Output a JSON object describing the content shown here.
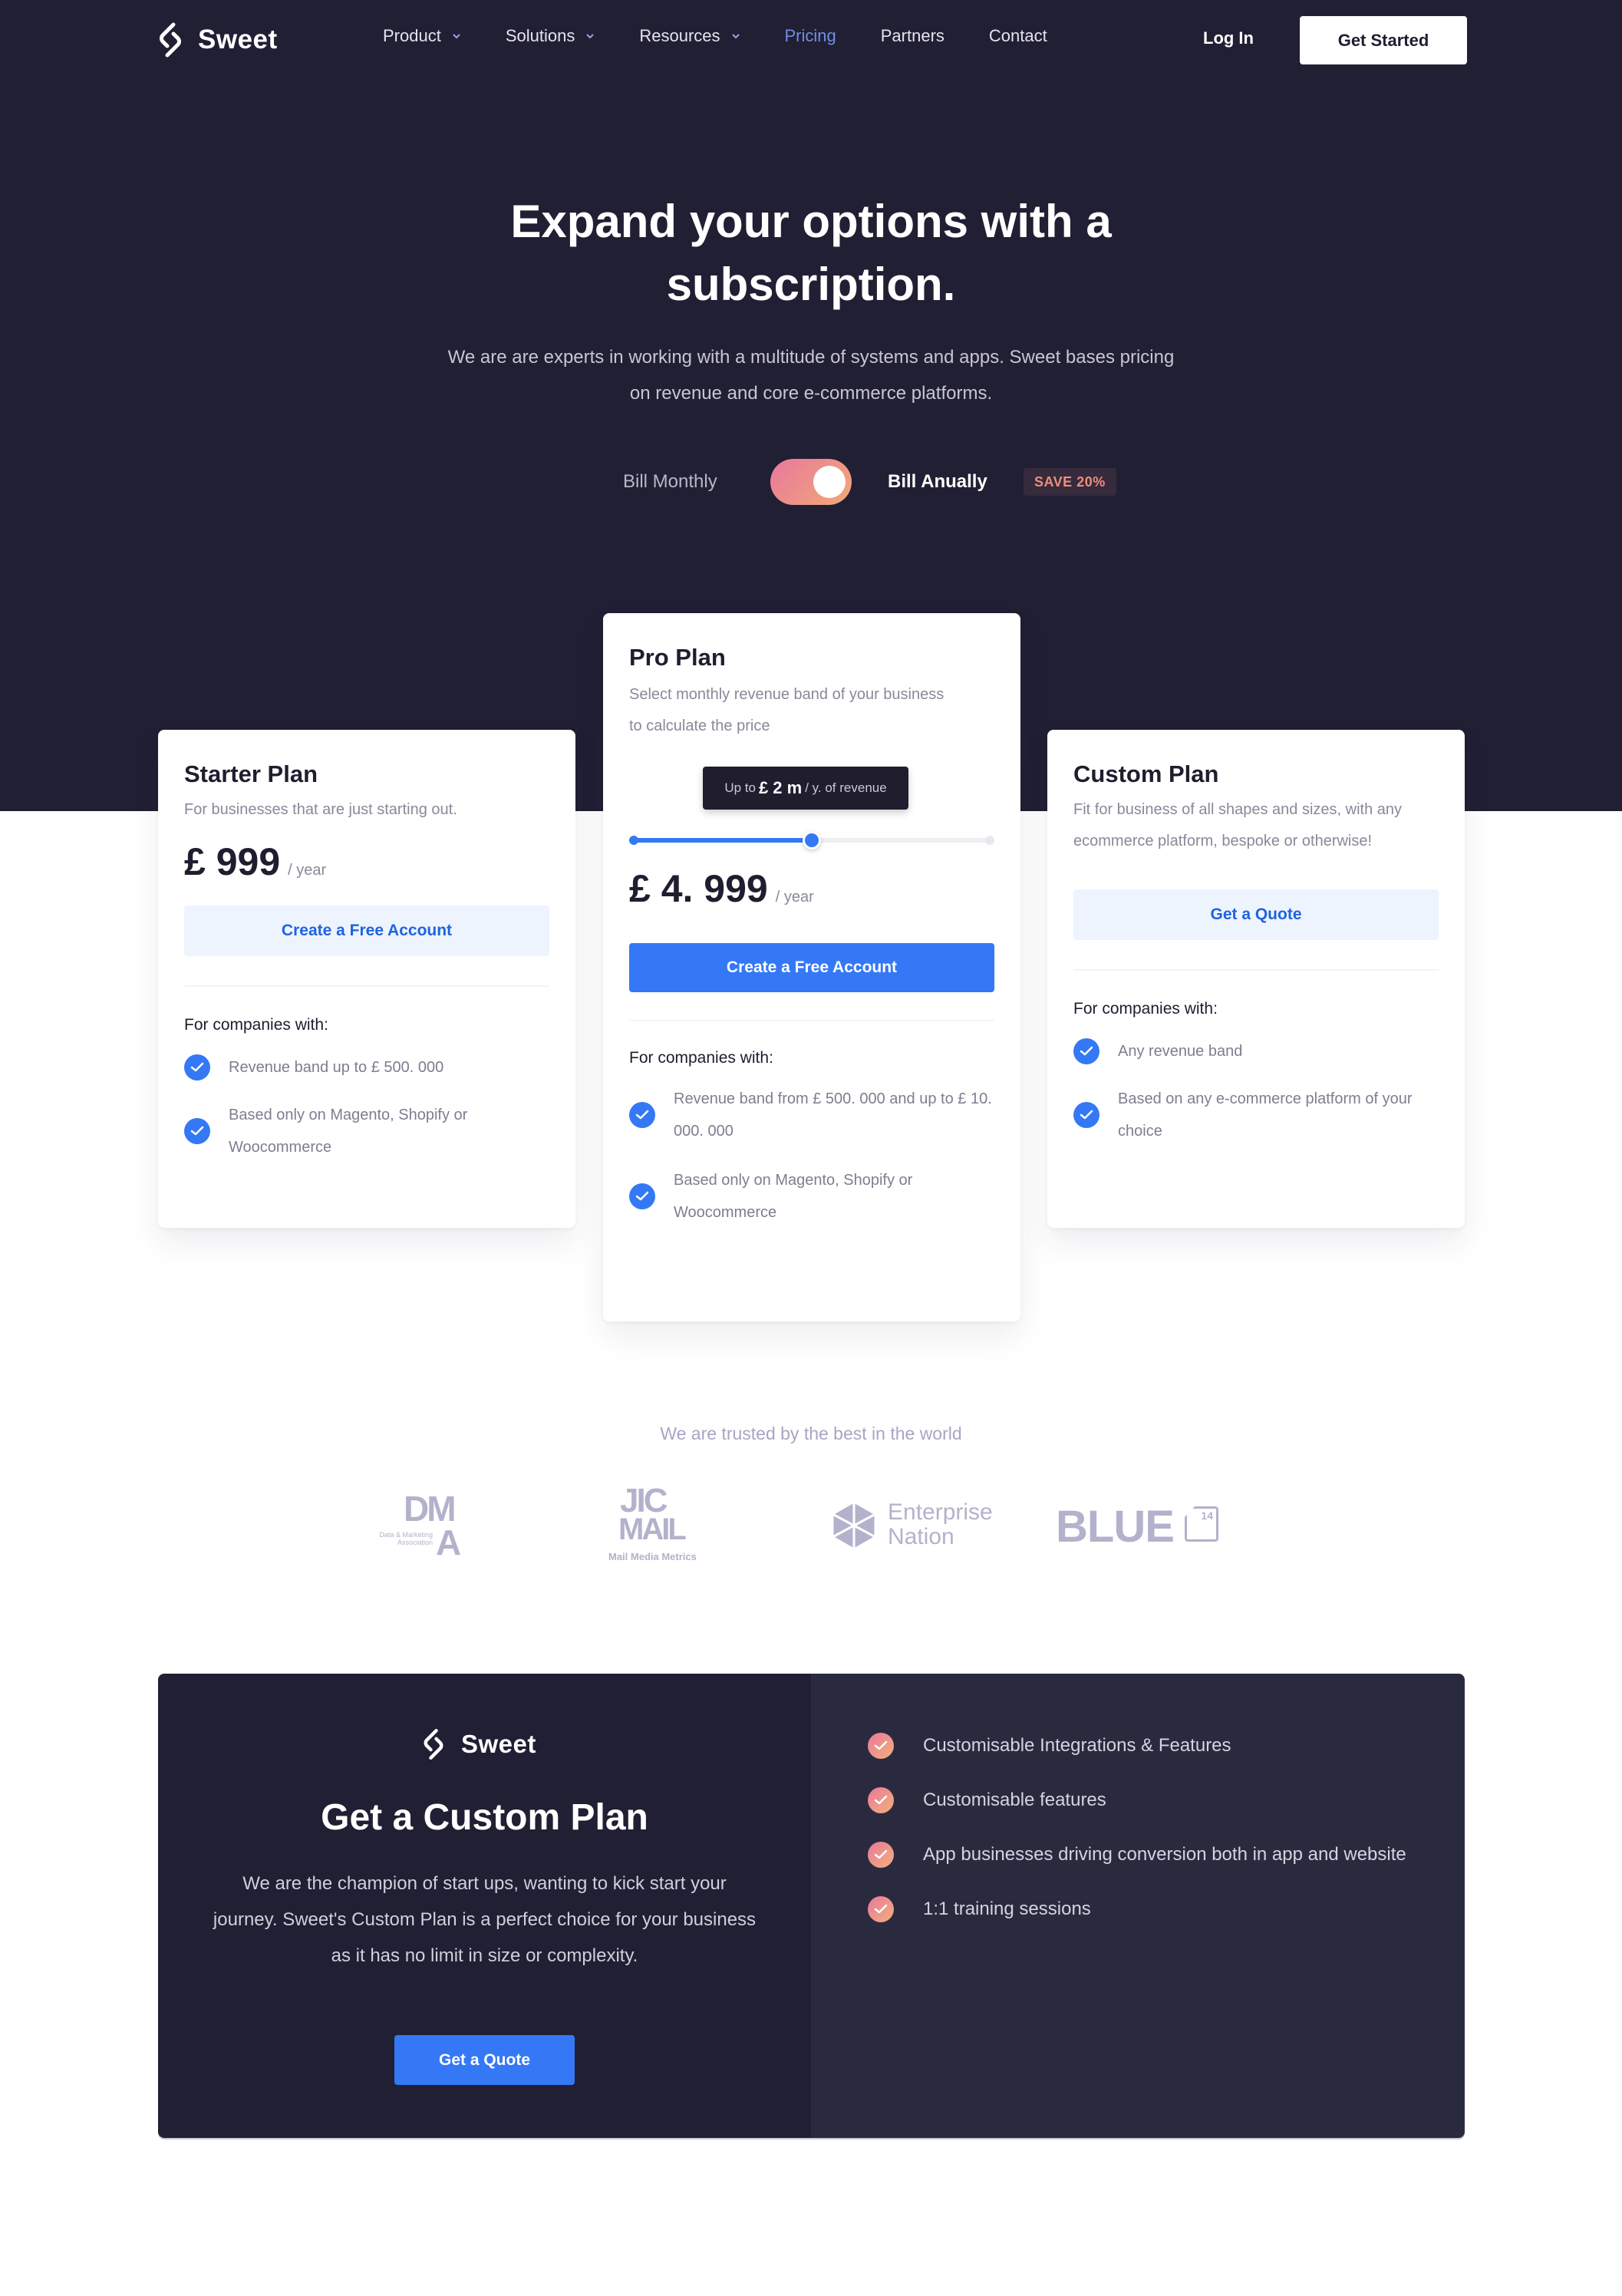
{
  "brand": {
    "name": "Sweet"
  },
  "nav": {
    "items": [
      {
        "label": "Product",
        "dropdown": true
      },
      {
        "label": "Solutions",
        "dropdown": true
      },
      {
        "label": "Resources",
        "dropdown": true
      },
      {
        "label": "Pricing",
        "dropdown": false,
        "active": true
      },
      {
        "label": "Partners",
        "dropdown": false
      },
      {
        "label": "Contact",
        "dropdown": false
      }
    ],
    "login_label": "Log In",
    "cta_label": "Get Started"
  },
  "hero": {
    "title_line1": "Expand your options with a",
    "title_line2": "subscription.",
    "subtitle_line1": "We are are experts in working with a multitude of systems and apps. Sweet bases pricing",
    "subtitle_line2": "on revenue and core e-commerce platforms."
  },
  "billing": {
    "monthly_label": "Bill Monthly",
    "annual_label": "Bill Anually",
    "selected": "annual",
    "save_badge": "SAVE 20%"
  },
  "plans": {
    "starter": {
      "title": "Starter Plan",
      "description": "For businesses that are just starting out.",
      "price": "£ 999",
      "period": "/ year",
      "button_label": "Create a Free Account",
      "companies_label": "For companies with:",
      "features": [
        "Revenue band up to £ 500. 000",
        "Based only on Magento, Shopify or Woocommerce"
      ]
    },
    "pro": {
      "title": "Pro Plan",
      "description": "Select monthly revenue band of your business to calculate the price",
      "slider": {
        "tooltip_prefix": "Up to",
        "tooltip_value": "£ 2 m",
        "tooltip_suffix": "/ y. of revenue",
        "value_fraction": 0.5
      },
      "price": "£ 4. 999",
      "period": "/ year",
      "button_label": "Create a Free Account",
      "companies_label": "For companies with:",
      "features": [
        "Revenue band from £ 500. 000 and up to £ 10. 000. 000",
        "Based only on Magento, Shopify or Woocommerce"
      ]
    },
    "custom": {
      "title": "Custom Plan",
      "description": "Fit for business of all shapes and sizes, with any ecommerce platform, bespoke or otherwise!",
      "button_label": "Get a Quote",
      "companies_label": "For companies with:",
      "features": [
        "Any revenue band",
        "Based on any e-commerce platform of your choice"
      ]
    }
  },
  "trusted": {
    "heading": "We are trusted by the best in the world",
    "logos": [
      {
        "name": "DMA",
        "top": "DM",
        "bottom": "A",
        "caption": "Data & Marketing Association"
      },
      {
        "name": "JICMAIL",
        "top": "JIC",
        "bottom": "MAIL",
        "caption": "Mail Media Metrics"
      },
      {
        "name": "Enterprise Nation",
        "line1": "Enterprise",
        "line2": "Nation"
      },
      {
        "name": "BLUE 14",
        "text": "BLUE",
        "badge": "14"
      }
    ]
  },
  "custom_cta": {
    "brand": "Sweet",
    "title": "Get a Custom Plan",
    "text": "We are the champion of start ups, wanting to kick start your journey. Sweet's Custom Plan is a perfect choice for your business as it has no limit in size or complexity.",
    "button_label": "Get a Quote",
    "features": [
      "Customisable Integrations & Features",
      "Customisable features",
      "App businesses driving conversion both in app and website",
      "1:1 training sessions"
    ]
  },
  "colors": {
    "dark_bg": "#211f33",
    "accent_blue": "#3478f6",
    "nav_active": "#6e8fe8",
    "toggle_gradient_start": "#e8789c",
    "toggle_gradient_end": "#f2a978",
    "save_badge_text": "#f08d7d"
  }
}
